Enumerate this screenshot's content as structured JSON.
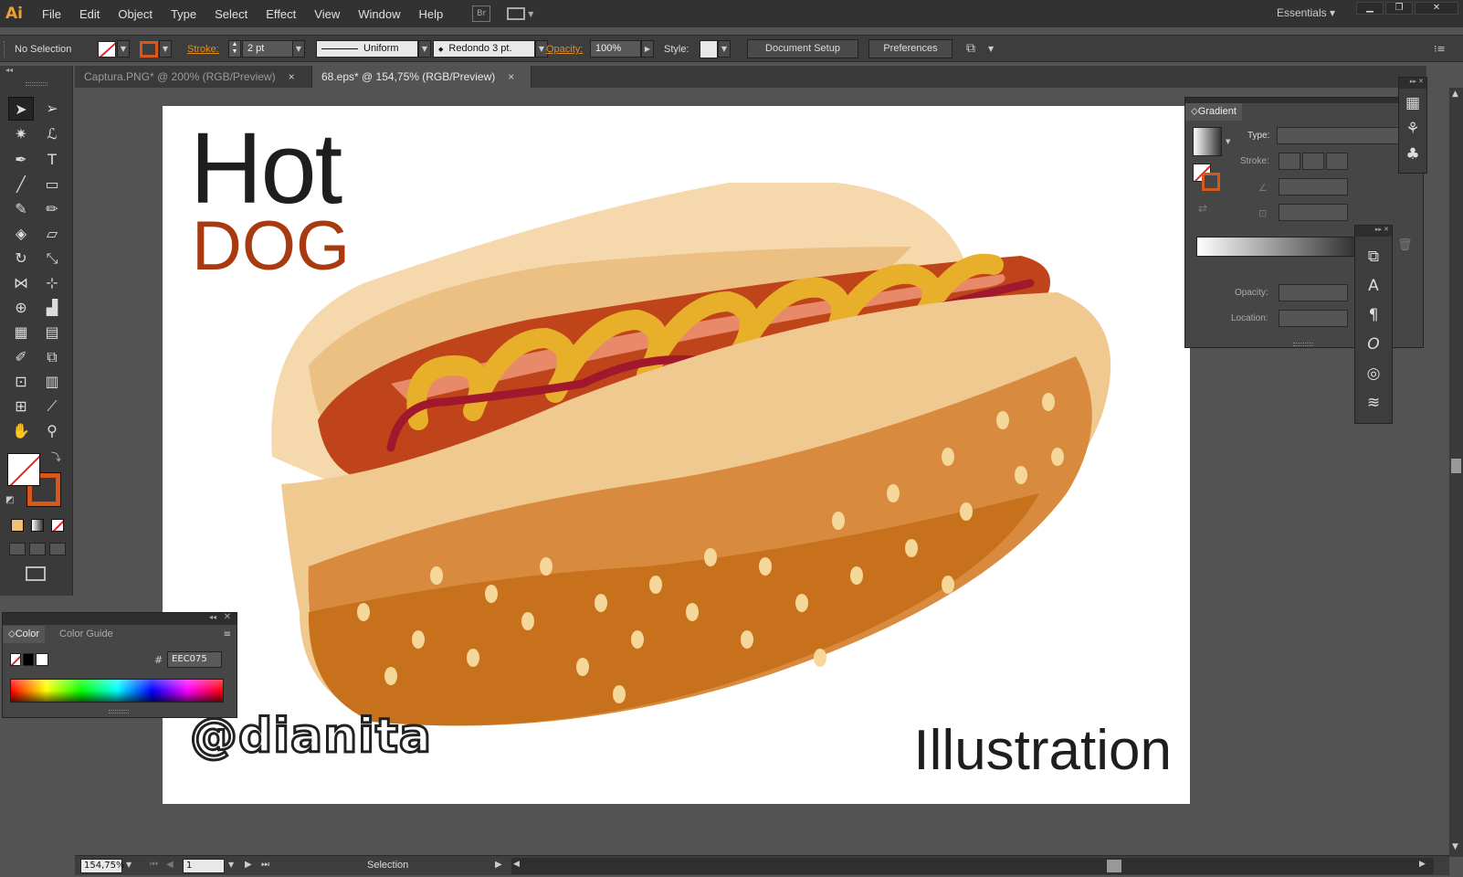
{
  "app": {
    "logo": "Ai"
  },
  "menu": [
    "File",
    "Edit",
    "Object",
    "Type",
    "Select",
    "Effect",
    "View",
    "Window",
    "Help"
  ],
  "menu_icons": {
    "bridge": "Br",
    "arrange": "arrange-documents-icon"
  },
  "workspace": "Essentials",
  "window_controls": [
    "minimize",
    "restore",
    "close"
  ],
  "control_bar": {
    "selection_status": "No Selection",
    "stroke_label": "Stroke:",
    "stroke_weight": "2 pt",
    "stroke_profile": "Uniform",
    "brush": "Redondo 3 pt.",
    "opacity_label": "Opacity:",
    "opacity_value": "100%",
    "style_label": "Style:",
    "document_setup": "Document Setup",
    "preferences": "Preferences"
  },
  "tabs": [
    {
      "label": "Captura.PNG* @ 200% (RGB/Preview)",
      "active": false
    },
    {
      "label": "68.eps* @ 154,75% (RGB/Preview)",
      "active": true
    }
  ],
  "artwork": {
    "title_line1": "Hot",
    "title_line2": "DOG",
    "signature": "@dianita",
    "label": "Illustration",
    "colors": {
      "title": "#1e1e1e",
      "dog": "#a83a10",
      "bun_light": "#f5d9ad",
      "bun_dark": "#d88a3e",
      "sausage": "#c0441a",
      "mustard": "#e8b02a",
      "ketchup": "#a0182c"
    }
  },
  "color_panel": {
    "tabs": [
      "Color",
      "Color Guide"
    ],
    "hex_label": "#",
    "hex_value": "EEC075"
  },
  "gradient_panel": {
    "title": "Gradient",
    "type_label": "Type:",
    "stroke_label": "Stroke:",
    "opacity_label": "Opacity:",
    "location_label": "Location:"
  },
  "status": {
    "zoom": "154,75%",
    "artboard": "1",
    "tool": "Selection"
  }
}
